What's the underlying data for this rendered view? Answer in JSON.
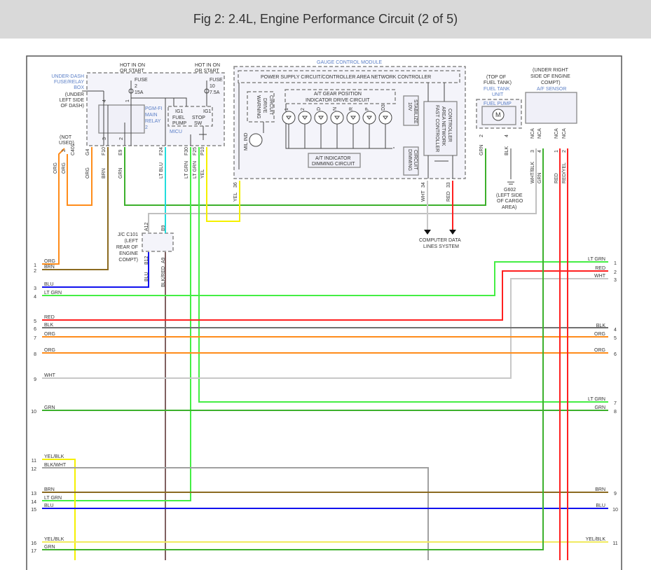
{
  "header": {
    "title": "Fig 2: 2.4L, Engine Performance Circuit (2 of 5)"
  },
  "colors": {
    "ORG": "#ff8c1a",
    "BRN": "#8b6a20",
    "GRN": "#3cb02c",
    "LT GRN": "#44ee44",
    "LT BLU": "#22dddd",
    "YEL": "#f5f000",
    "BLU": "#1111ee",
    "RED": "#ff2020",
    "BLK": "#707070",
    "WHT": "#c8c8c8",
    "BLK/RED": "#806060"
  },
  "fuse_box": {
    "hot1": "HOT IN ON",
    "hot1b": "OR START",
    "hot2": "HOT IN ON",
    "hot2b": "OR START",
    "name": [
      "UNDER-DASH",
      "FUSE/RELAY",
      "BOX"
    ],
    "loc": [
      "(UNDER",
      "LEFT SIDE",
      "OF DASH)"
    ],
    "fuse1": [
      "FUSE",
      "2",
      "15A"
    ],
    "fuse2": [
      "FUSE",
      "10",
      "7.5A"
    ],
    "relay": [
      "PGM-FI",
      "MAIN",
      "RELAY",
      "2"
    ],
    "micu": "MICU",
    "ig1a": "IG1",
    "fuel_pump": [
      "FUEL",
      "PUMP"
    ],
    "ig1b": "IG1",
    "stop_sw": [
      "STOP",
      "SW"
    ],
    "pins": [
      "4",
      "1",
      "3",
      "2"
    ],
    "not_used": [
      "(NOT",
      "USED)"
    ],
    "c401_pin": "2",
    "c401": "C401"
  },
  "left_wires": [
    {
      "pin": "G4",
      "color": "ORG"
    },
    {
      "pin": "F10",
      "color": "BRN"
    },
    {
      "pin": "E9",
      "color": "GRN"
    },
    {
      "pin": "F24",
      "color": "LT BLU"
    },
    {
      "pin": "F30",
      "color": "LT GRN"
    },
    {
      "pin": "F25",
      "color": "LT GRN"
    },
    {
      "pin": "P10",
      "color": "YEL"
    }
  ],
  "c401_wires": [
    "ORG",
    "ORG"
  ],
  "jc": {
    "name": [
      "J/C C101",
      "(LEFT",
      "REAR OF",
      "ENGINE",
      "COMPT)"
    ],
    "pins": [
      "A12",
      "B9",
      "B12",
      "A9"
    ],
    "wires": [
      "BLU",
      "BLK/RED"
    ]
  },
  "gcm": {
    "title": "GAUGE CONTROL MODULE",
    "power": "POWER SUPPLY CIRCUIT/CONTROLLER AREA NETWORK CONTROLLER",
    "warning": [
      "WARNING",
      "DRIVE",
      "CIRCUIT"
    ],
    "gear": [
      "A/T GEAR POSITION",
      "INDICATOR DRIVE CIRCUIT"
    ],
    "leds": [
      "1",
      "2",
      "D",
      "N",
      "R",
      "P",
      "D3"
    ],
    "stab": [
      "10V",
      "STABILIZE"
    ],
    "fast": [
      "FAST CONTROLLER",
      "AREA NETWORK",
      "CONTROLLER"
    ],
    "dimming": [
      "A/T INDICATOR",
      "DIMMING CIRCUIT"
    ],
    "dim2": [
      "DIMMING",
      "CIRCUIT"
    ],
    "mil": "MIL IND",
    "pins": [
      {
        "pin": "36",
        "color": "YEL"
      },
      {
        "pin": "34",
        "color": "WHT"
      },
      {
        "pin": "33",
        "color": "RED"
      }
    ],
    "data_lines": [
      "COMPUTER DATA",
      "LINES SYSTEM"
    ]
  },
  "fuel_tank": {
    "loc": [
      "(TOP OF",
      "FUEL TANK)"
    ],
    "name": [
      "FUEL TANK",
      "UNIT"
    ],
    "pump": "FUEL PUMP",
    "motor": "M",
    "pins": [
      {
        "pin": "2",
        "color": "GRN"
      },
      {
        "pin": "4",
        "color": "BLK"
      }
    ],
    "ground": [
      "G602",
      "(LEFT SIDE",
      "OF CARGO",
      "AREA)"
    ]
  },
  "af_sensor": {
    "loc": [
      "(UNDER RIGHT",
      "SIDE OF ENGINE",
      "COMPT)"
    ],
    "name": "A/F SENSOR",
    "pins": [
      {
        "pin": "3",
        "nca": "NCA",
        "color": "WHT/BLK"
      },
      {
        "pin": "4",
        "nca": "NCA",
        "color": "GRN"
      },
      {
        "pin": "1",
        "nca": "NCA",
        "color": "RED"
      },
      {
        "pin": "2",
        "nca": "NCA",
        "color": "RED/YEL"
      }
    ]
  },
  "left_rows": [
    {
      "n": "1",
      "label": "ORG"
    },
    {
      "n": "2",
      "label": "BRN"
    },
    {
      "n": "3",
      "label": "BLU"
    },
    {
      "n": "4",
      "label": "LT GRN"
    },
    {
      "n": "5",
      "label": "RED"
    },
    {
      "n": "6",
      "label": "BLK"
    },
    {
      "n": "7",
      "label": "ORG"
    },
    {
      "n": "8",
      "label": "ORG"
    },
    {
      "n": "9",
      "label": "WHT"
    },
    {
      "n": "10",
      "label": "GRN"
    },
    {
      "n": "11",
      "label": "YEL/BLK"
    },
    {
      "n": "12",
      "label": "BLK/WHT"
    },
    {
      "n": "13",
      "label": "BRN"
    },
    {
      "n": "14",
      "label": "LT GRN"
    },
    {
      "n": "15",
      "label": "BLU"
    },
    {
      "n": "16",
      "label": "YEL/BLK"
    },
    {
      "n": "17",
      "label": "GRN"
    }
  ],
  "right_rows": [
    {
      "n": "1",
      "label": "LT GRN"
    },
    {
      "n": "2",
      "label": "RED"
    },
    {
      "n": "3",
      "label": "WHT"
    },
    {
      "n": "4",
      "label": "BLK"
    },
    {
      "n": "5",
      "label": "ORG"
    },
    {
      "n": "6",
      "label": "ORG"
    },
    {
      "n": "7",
      "label": "LT GRN"
    },
    {
      "n": "8",
      "label": "GRN"
    },
    {
      "n": "9",
      "label": "BRN"
    },
    {
      "n": "10",
      "label": "BLU"
    },
    {
      "n": "11",
      "label": "YEL/BLK"
    }
  ]
}
